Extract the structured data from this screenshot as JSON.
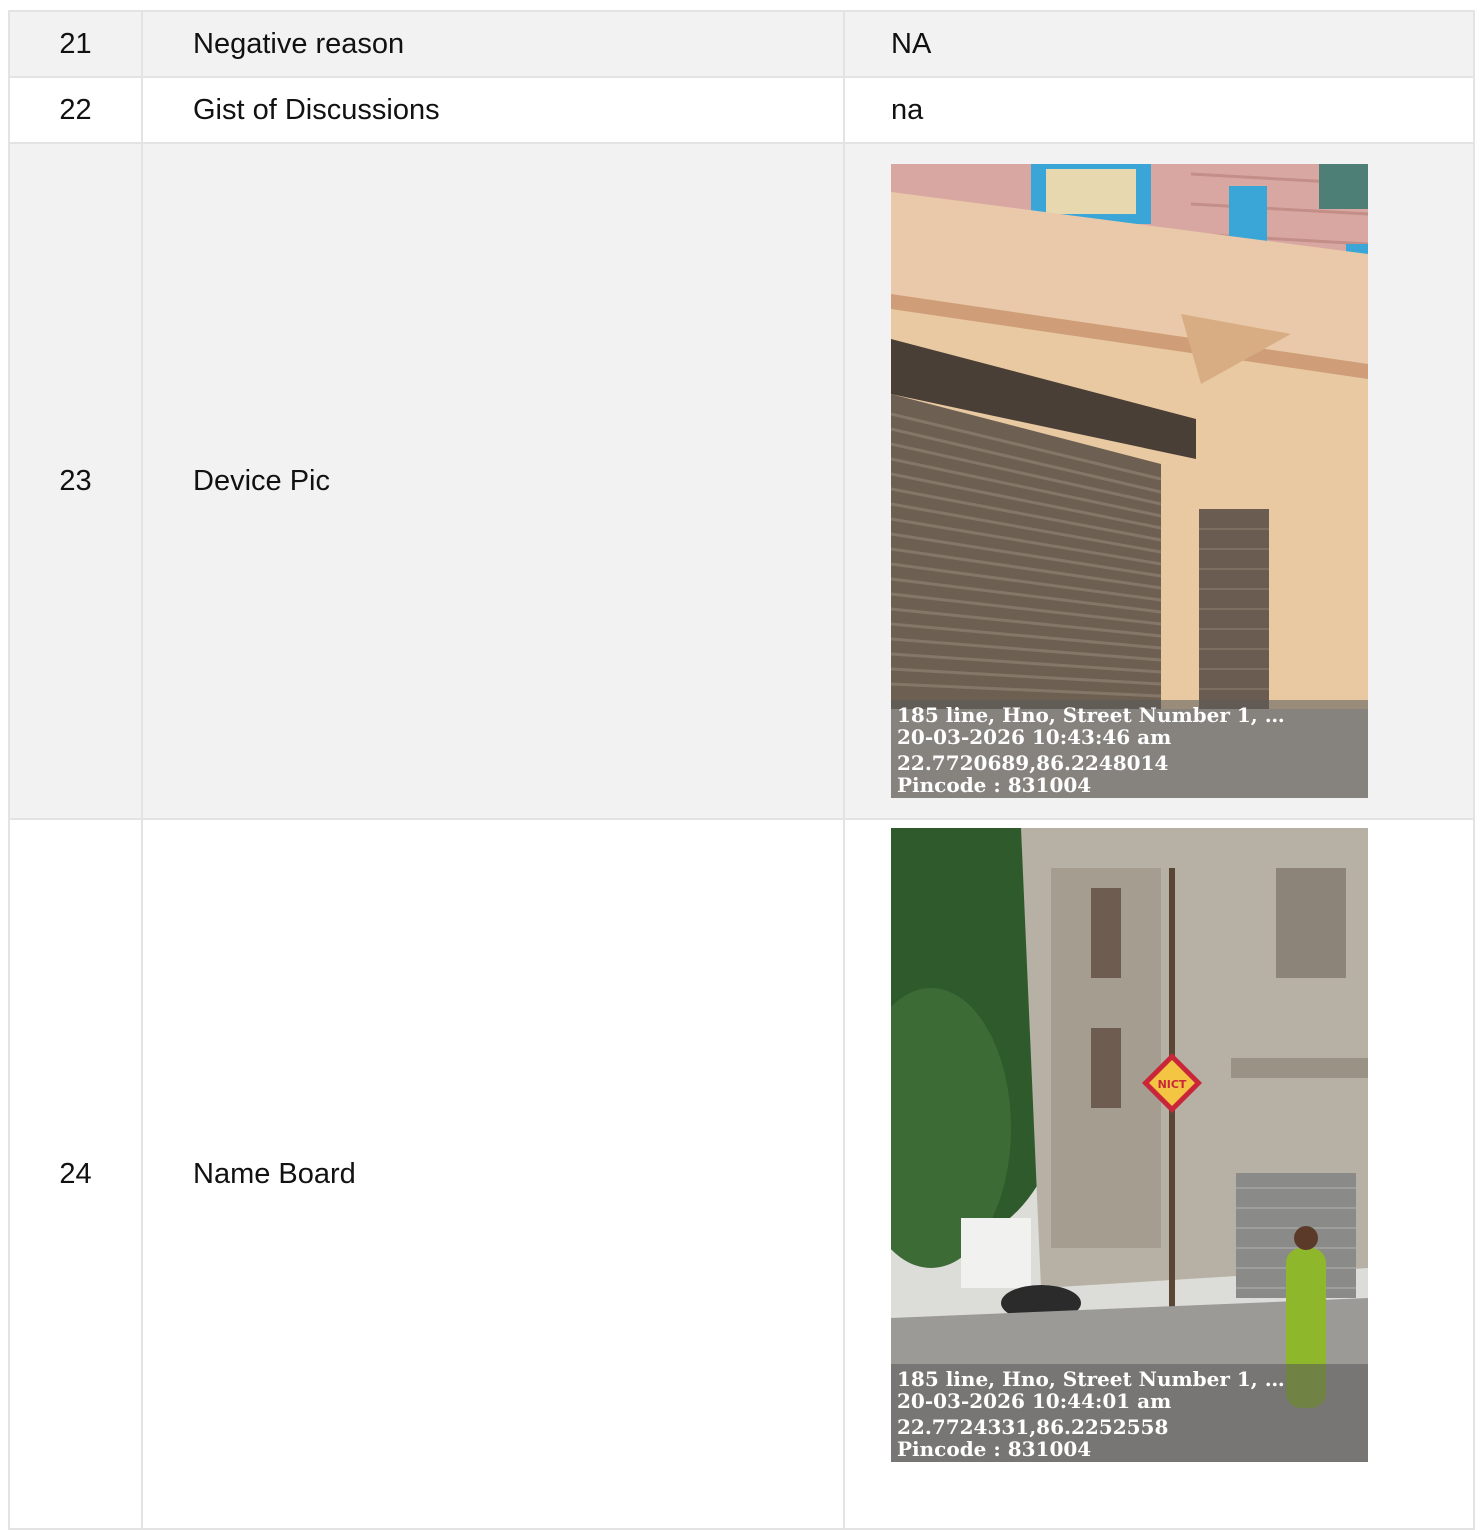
{
  "rows": [
    {
      "num": "21",
      "field": "Negative reason",
      "value": "NA"
    },
    {
      "num": "22",
      "field": "Gist of Discussions",
      "value": "na"
    },
    {
      "num": "23",
      "field": "Device Pic"
    },
    {
      "num": "24",
      "field": "Name Board"
    }
  ],
  "photos": {
    "device_pic": {
      "address": "185 line, Hno, Street Number 1, …",
      "datetime": "20-03-2026 10:43:46 am",
      "coords": "22.7720689,86.2248014",
      "pincode": "Pincode : 831004"
    },
    "name_board": {
      "address": "185 line, Hno, Street Number 1, …",
      "datetime": "20-03-2026 10:44:01 am",
      "coords": "22.7724331,86.2252558",
      "pincode": "Pincode : 831004",
      "sign_text": "NICT"
    }
  },
  "colors": {
    "row_alt_bg": "#f2f2f2",
    "border": "#e3e3e3"
  }
}
